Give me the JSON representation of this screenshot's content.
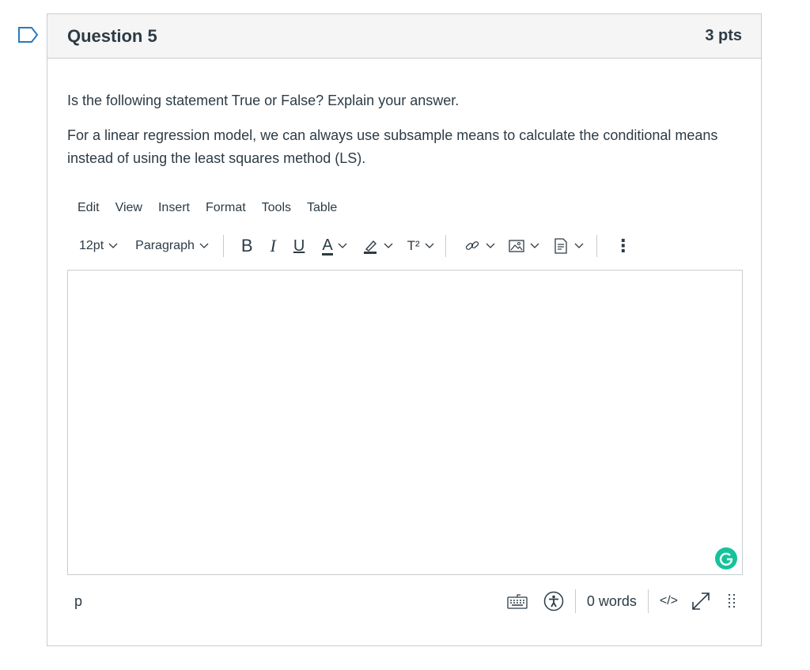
{
  "question": {
    "title": "Question 5",
    "points": "3 pts",
    "paragraphs": [
      "Is the following statement True or False? Explain your answer.",
      "For a linear regression model, we can always use subsample means to calculate the conditional means instead of using the least squares method (LS)."
    ]
  },
  "editor": {
    "menu": [
      "Edit",
      "View",
      "Insert",
      "Format",
      "Tools",
      "Table"
    ],
    "font_size": "12pt",
    "block_format": "Paragraph",
    "bold_label": "B",
    "italic_label": "I",
    "underline_label": "U",
    "text_color_label": "A",
    "superscript_label": "T²",
    "more_label": "⋮",
    "status_path": "p",
    "word_count": "0 words",
    "html_label": "</>"
  },
  "icons": {
    "flag": "flag-icon",
    "highlight": "highlighter-icon",
    "link": "link-icon",
    "image": "image-icon",
    "document": "document-icon",
    "keyboard": "keyboard-icon",
    "accessibility": "accessibility-icon",
    "fullscreen": "expand-icon",
    "resize": "resize-handle-icon",
    "grammarly": "grammarly-icon"
  },
  "colors": {
    "text": "#2d3b45",
    "border": "#c7cdd1",
    "header_bg": "#f5f5f5",
    "grammarly": "#15c39a"
  }
}
